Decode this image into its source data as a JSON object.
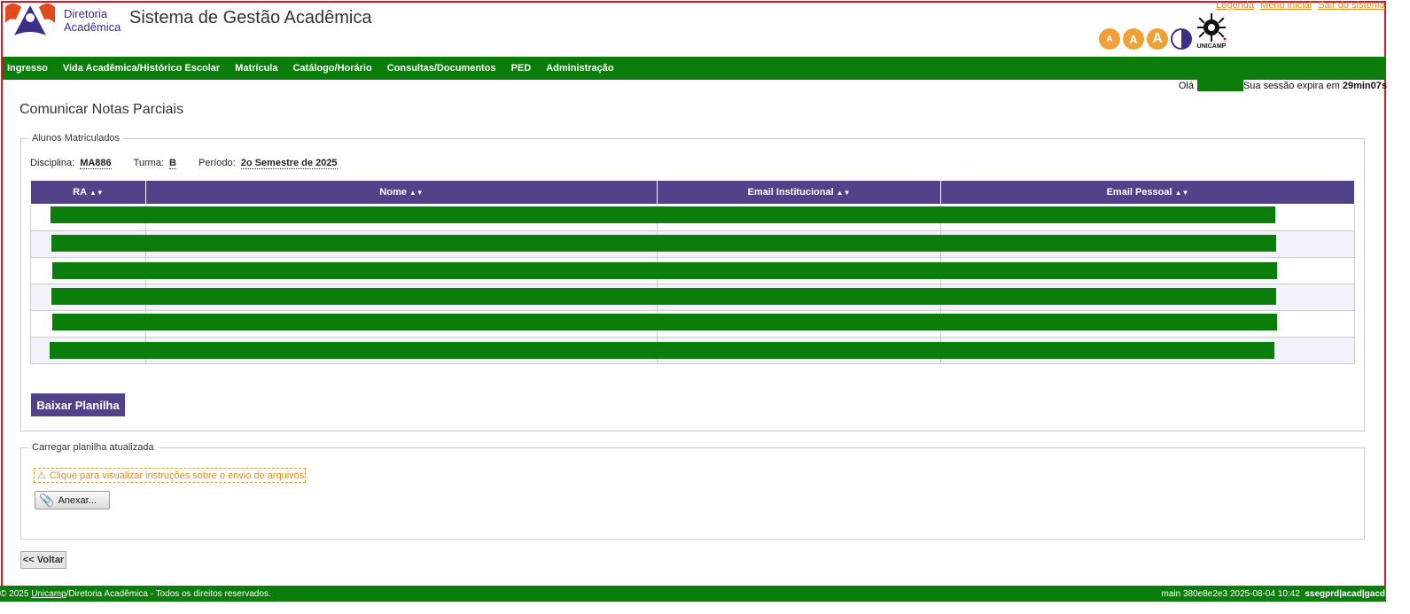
{
  "header": {
    "org_line1": "Diretoria",
    "org_line2": "Acadêmica",
    "title": "Sistema de Gestão Acadêmica",
    "links": [
      "Legenda",
      "Menu inicial",
      "Sair do sistema"
    ],
    "accessibility": [
      "A",
      "A",
      "A"
    ],
    "university_label": "UNICAMP"
  },
  "nav": {
    "items": [
      "Ingresso",
      "Vida Acadêmica/Histórico Escolar",
      "Matrícula",
      "Catálogo/Horário",
      "Consultas/Documentos",
      "PED",
      "Administração"
    ]
  },
  "session": {
    "greeting": "Olá",
    "expires_text": "Sua sessão expira em",
    "time_left": "29min07s"
  },
  "page": {
    "title": "Comunicar Notas Parciais"
  },
  "enrolled": {
    "legend": "Alunos Matriculados",
    "disciplina_label": "Disciplina:",
    "disciplina": "MA886",
    "turma_label": "Turma:",
    "turma": "B",
    "periodo_label": "Período:",
    "periodo": "2o Semestre de 2025",
    "columns": [
      "RA",
      "Nome",
      "Email Institucional",
      "Email Pessoal"
    ],
    "row_count": 6,
    "download_label": "Baixar Planilha"
  },
  "upload": {
    "legend": "Carregar planilha atualizada",
    "instructions": "Clique para visualizar instruções sobre o envio de arquivos",
    "attach_label": "Anexar..."
  },
  "back_label": "<< Voltar",
  "footer": {
    "copyright_prefix": "© 2025",
    "copyright_link": "Unicamp",
    "copyright_rest": "/Diretoria Acadêmica - Todos os direitos reservados.",
    "build": "main 380e8e2e3 2025-08-04 10:42",
    "server": "ssegprd|acad|gacd"
  },
  "colors": {
    "primary_green": "#0a7d0a",
    "header_purple": "#524289",
    "link_orange": "#e98a1b"
  }
}
